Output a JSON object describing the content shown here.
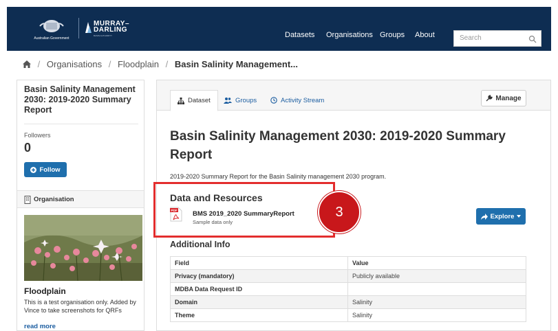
{
  "header": {
    "logo_gov_text": "Australian Government",
    "logo_brand_line1": "MURRAY–",
    "logo_brand_line2": "DARLING",
    "logo_brand_line3": "BASIN AUTHORITY",
    "nav": [
      "Datasets",
      "Organisations",
      "Groups",
      "About"
    ],
    "search_placeholder": "Search"
  },
  "breadcrumb": {
    "items": [
      "Organisations",
      "Floodplain"
    ],
    "current": "Basin Salinity Management..."
  },
  "sidebar": {
    "title": "Basin Salinity Management 2030: 2019-2020 Summary Report",
    "followers_label": "Followers",
    "followers_count": "0",
    "follow_button": "Follow",
    "org_heading": "Organisation",
    "org_name": "Floodplain",
    "org_description": "This is a test organisation only. Added by Vince to take screenshots for QRFs",
    "read_more": "read more"
  },
  "main": {
    "tabs": [
      "Dataset",
      "Groups",
      "Activity Stream"
    ],
    "manage_button": "Manage",
    "title": "Basin Salinity Management 2030: 2019-2020 Summary Report",
    "description": "2019-2020 Summary Report for the Basin Salinity management 2030 program.",
    "resources_heading": "Data and Resources",
    "resource": {
      "icon_label": "PDF",
      "name": "BMS 2019_2020 SummaryReport",
      "subtitle": "Sample data only",
      "explore_button": "Explore"
    },
    "additional_info_heading": "Additional Info",
    "table": {
      "headers": [
        "Field",
        "Value"
      ],
      "rows": [
        [
          "Privacy (mandatory)",
          "Publicly available"
        ],
        [
          "MDBA Data Request ID",
          ""
        ],
        [
          "Domain",
          "Salinity"
        ],
        [
          "Theme",
          "Salinity"
        ]
      ]
    }
  },
  "annotation": {
    "badge": "3",
    "color": "#c8171b"
  },
  "colors": {
    "header_bg": "#0e2d52",
    "primary_button": "#1f6fad",
    "link": "#1b5da0"
  }
}
